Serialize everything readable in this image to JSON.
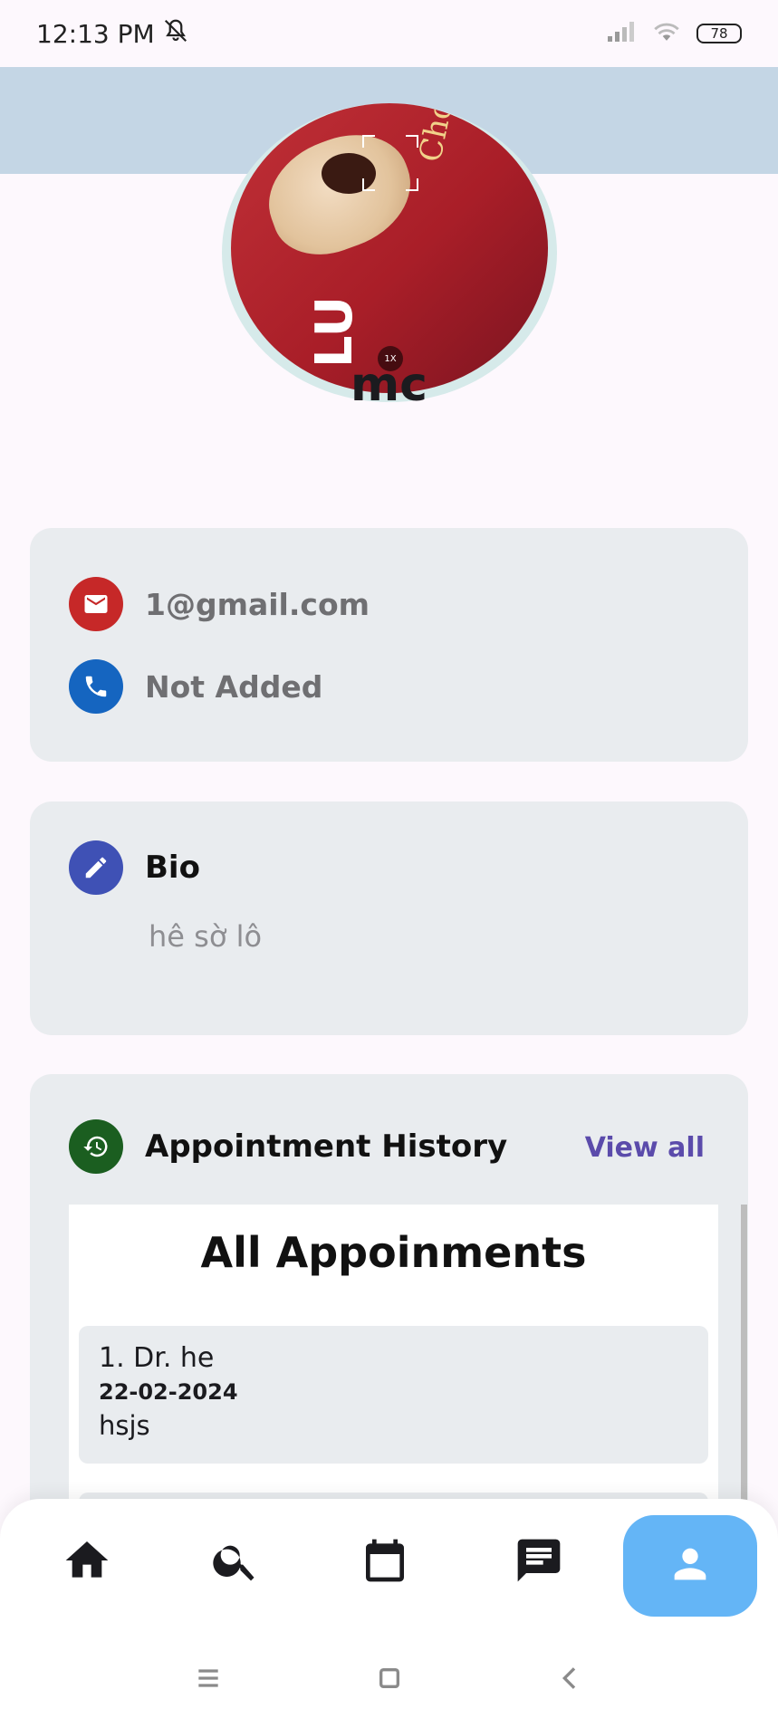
{
  "status_bar": {
    "time": "12:13 PM",
    "battery": "78",
    "icons": [
      "mute-icon",
      "signal-icon",
      "wifi-icon",
      "battery-icon"
    ]
  },
  "profile": {
    "avatar_text": "Choco Lava",
    "avatar_logo": "LU",
    "avatar_zoom_badge": "1X",
    "name": "mc"
  },
  "contact": {
    "email": "1@gmail.com",
    "phone": "Not Added",
    "email_icon": "mail-icon",
    "phone_icon": "phone-icon"
  },
  "bio": {
    "title": "Bio",
    "text": "hê sờ lô",
    "icon": "pencil-icon"
  },
  "history": {
    "title": "Appointment History",
    "view_all": "View all",
    "icon": "history-icon",
    "panel_title": "All Appoinments",
    "appointments": [
      {
        "doctor": "1. Dr. he",
        "date": "22-02-2024",
        "note": "hsjs"
      }
    ]
  },
  "bottom_nav": {
    "items": [
      "home-icon",
      "search-icon",
      "calendar-icon",
      "chat-icon",
      "profile-icon"
    ],
    "active": "profile-icon",
    "active_color": "#64b5f6"
  },
  "colors": {
    "cover": "#c4d6e5",
    "email_icon_bg": "#c62828",
    "phone_icon_bg": "#1565c0",
    "bio_icon_bg": "#3f51b5",
    "history_icon_bg": "#1b5e20",
    "view_all": "#5b4bab"
  }
}
